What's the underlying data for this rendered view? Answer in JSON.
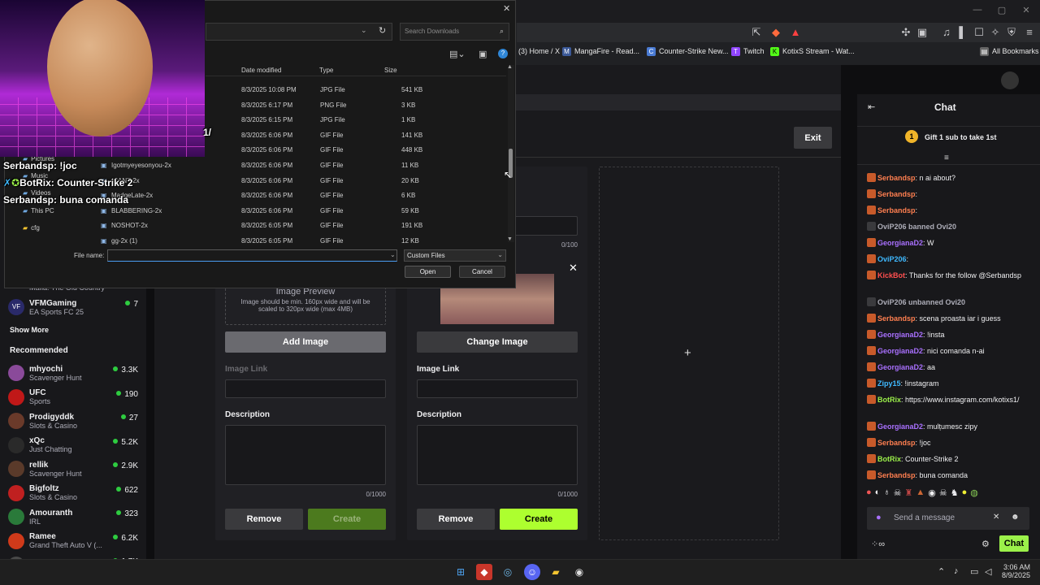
{
  "colors": {
    "accent": "#a970ff",
    "create_green": "#adff2f",
    "chat_btn": "#9bf04a"
  },
  "bookmarks": [
    "(3) Home / X",
    "MangaFire - Read...",
    "Counter-Strike New...",
    "Twitch",
    "KotixS Stream - Wat...",
    "All Bookmarks"
  ],
  "dialog": {
    "search_placeholder": "Search Downloads",
    "cols": {
      "date": "Date modified",
      "type": "Type",
      "size": "Size"
    },
    "nav_items": [
      {
        "label": "Pictures"
      },
      {
        "label": "Music"
      },
      {
        "label": "Videos"
      },
      {
        "label": "This PC"
      },
      {
        "label": "cfg"
      }
    ],
    "files": [
      {
        "name": "",
        "date": "8/3/2025 10:08 PM",
        "type": "JPG File",
        "size": "541 KB"
      },
      {
        "name": "",
        "date": "8/3/2025 6:17 PM",
        "type": "PNG File",
        "size": "3 KB"
      },
      {
        "name": "",
        "date": "8/3/2025 6:15 PM",
        "type": "JPG File",
        "size": "1 KB"
      },
      {
        "name": "",
        "date": "8/3/2025 6:06 PM",
        "type": "GIF File",
        "size": "141 KB"
      },
      {
        "name": "",
        "date": "8/3/2025 6:06 PM",
        "type": "GIF File",
        "size": "448 KB"
      },
      {
        "name": "Igotmyeyesonyou-2x",
        "date": "8/3/2025 6:06 PM",
        "type": "GIF File",
        "size": "11 KB"
      },
      {
        "name": "ICANT-2x",
        "date": "8/3/2025 6:06 PM",
        "type": "GIF File",
        "size": "20 KB"
      },
      {
        "name": "MadgeLate-2x",
        "date": "8/3/2025 6:06 PM",
        "type": "GIF File",
        "size": "6 KB"
      },
      {
        "name": "BLABBERING-2x",
        "date": "8/3/2025 6:06 PM",
        "type": "GIF File",
        "size": "59 KB"
      },
      {
        "name": "NOSHOT-2x",
        "date": "8/3/2025 6:05 PM",
        "type": "GIF File",
        "size": "191 KB"
      },
      {
        "name": "gg-2x (1)",
        "date": "8/3/2025 6:05 PM",
        "type": "GIF File",
        "size": "12 KB"
      }
    ],
    "file_name_label": "File name:",
    "file_type": "Custom Files",
    "open": "Open",
    "cancel": "Cancel"
  },
  "overlay": {
    "t1": "Serbandsp: !joc",
    "t2": "BotRix: Counter-Strike 2",
    "t3": "Serbandsp: buna comanda",
    "t4": "1/"
  },
  "sidebar": {
    "partial": "Mafia: The Old Country",
    "top": [
      {
        "name": "VFMGaming",
        "game": "EA Sports FC 25",
        "viewers": "7"
      }
    ],
    "show_more": "Show More",
    "recommended": "Recommended",
    "channels": [
      {
        "name": "mhyochi",
        "game": "Scavenger Hunt",
        "viewers": "3.3K"
      },
      {
        "name": "UFC",
        "game": "Sports",
        "viewers": "190"
      },
      {
        "name": "Prodigyddk",
        "game": "Slots & Casino",
        "viewers": "27"
      },
      {
        "name": "xQc",
        "game": "Just Chatting",
        "viewers": "5.2K"
      },
      {
        "name": "rellik",
        "game": "Scavenger Hunt",
        "viewers": "2.9K"
      },
      {
        "name": "Bigfoltz",
        "game": "Slots & Casino",
        "viewers": "622"
      },
      {
        "name": "Amouranth",
        "game": "IRL",
        "viewers": "323"
      },
      {
        "name": "Ramee",
        "game": "Grand Theft Auto V (...",
        "viewers": "6.2K"
      },
      {
        "name": "demisux",
        "game": "",
        "viewers": "1.7K"
      }
    ]
  },
  "editor": {
    "exit": "Exit",
    "counter_top": "0/100",
    "preview_title": "Image Preview",
    "preview_hint": "Image should be min. 160px wide and will be scaled to 320px wide (max 4MB)",
    "add_image": "Add Image",
    "change_image": "Change Image",
    "image_link": "Image Link",
    "description": "Description",
    "desc_count": "0/1000",
    "remove": "Remove",
    "create": "Create",
    "close": "✕",
    "plus": "+"
  },
  "chat": {
    "title": "Chat",
    "gift": "Gift 1 sub to take 1st",
    "placeholder": "Send a message",
    "send": "Chat",
    "messages": [
      {
        "user": "Serbandsp",
        "color": "#ff7f50",
        "text": ": n ai about?"
      },
      {
        "user": "Serbandsp",
        "color": "#ff7f50",
        "text": ": "
      },
      {
        "user": "Serbandsp",
        "color": "#ff7f50",
        "text": ": "
      },
      {
        "user": "",
        "color": "#adadb8",
        "text": "OviP206 banned Ovi20"
      },
      {
        "user": "GeorgianaD2",
        "color": "#a970ff",
        "text": ": W"
      },
      {
        "user": "OviP206",
        "color": "#3fb9ff",
        "text": ": "
      },
      {
        "user": "KickBot",
        "color": "#ff4f4f",
        "text": ": Thanks for the follow @Serbandsp"
      },
      {
        "user": "",
        "color": "#adadb8",
        "text": "OviP206 unbanned Ovi20"
      },
      {
        "user": "Serbandsp",
        "color": "#ff7f50",
        "text": ": scena proasta iar i guess"
      },
      {
        "user": "GeorgianaD2",
        "color": "#a970ff",
        "text": ": !insta"
      },
      {
        "user": "GeorgianaD2",
        "color": "#a970ff",
        "text": ": nici comanda n-ai"
      },
      {
        "user": "GeorgianaD2",
        "color": "#a970ff",
        "text": ": aa"
      },
      {
        "user": "Zipy15",
        "color": "#3fb9ff",
        "text": ": !instagram"
      },
      {
        "user": "BotRix",
        "color": "#9bf04a",
        "text": ": https://www.instagram.com/kotixs1/"
      },
      {
        "user": "GeorgianaD2",
        "color": "#a970ff",
        "text": ": mulțumesc zipy"
      },
      {
        "user": "Serbandsp",
        "color": "#ff7f50",
        "text": ": !joc"
      },
      {
        "user": "BotRix",
        "color": "#9bf04a",
        "text": ": Counter-Strike 2"
      },
      {
        "user": "Serbandsp",
        "color": "#ff7f50",
        "text": ": buna comanda"
      }
    ]
  },
  "clock": {
    "time": "3:06 AM",
    "date": "8/9/2025"
  }
}
